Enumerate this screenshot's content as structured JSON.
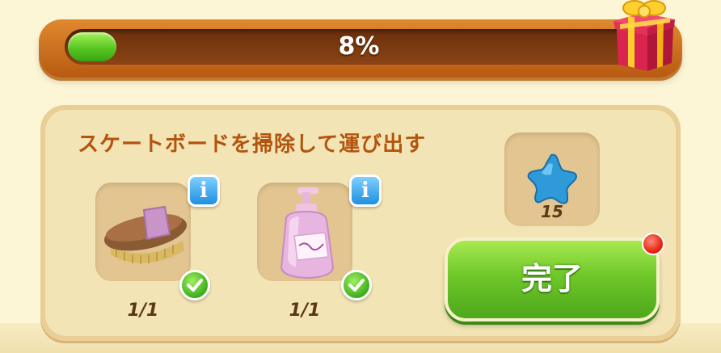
{
  "progress": {
    "label": "8%",
    "fraction": 0.08
  },
  "task": {
    "title": "スケートボードを掃除して運び出す",
    "items": [
      {
        "icon": "brush-icon",
        "count": "1/1",
        "completed": true
      },
      {
        "icon": "soap-bottle-icon",
        "count": "1/1",
        "completed": true
      }
    ]
  },
  "reward": {
    "icon": "blue-star-icon",
    "amount": "15"
  },
  "done_button": {
    "label": "完了",
    "notification": true
  },
  "colors": {
    "progress_fill": "#52c320",
    "title_text": "#b3550e",
    "done_button": "#6ec72a",
    "info_button": "#1f8fe0",
    "notification_dot": "#e3200e"
  }
}
